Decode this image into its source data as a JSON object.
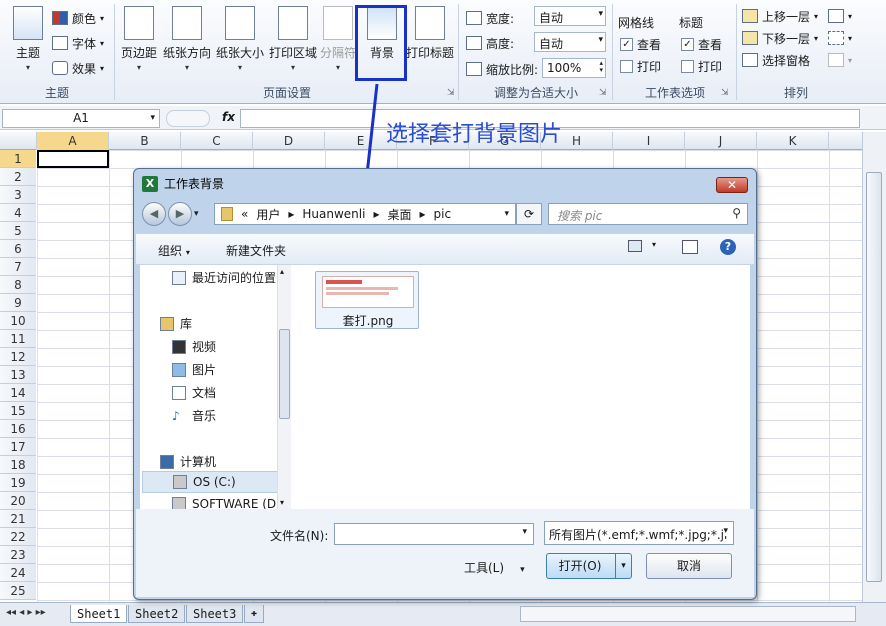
{
  "ribbon": {
    "groups": {
      "theme": "主题",
      "page_setup": "页面设置",
      "scale_to_fit": "调整为合适大小",
      "sheet_options": "工作表选项",
      "arrange": "排列"
    },
    "theme_btn": "主题",
    "colors": "颜色",
    "fonts": "字体",
    "effects": "效果",
    "margins": "页边距",
    "orientation": "纸张方向",
    "size": "纸张大小",
    "print_area": "打印区域",
    "breaks": "分隔符",
    "background": "背景",
    "print_titles": "打印标题",
    "width_label": "宽度:",
    "width_value": "自动",
    "height_label": "高度:",
    "height_value": "自动",
    "scale_label": "缩放比例:",
    "scale_value": "100%",
    "gridlines": "网格线",
    "headings": "标题",
    "view": "查看",
    "print": "打印",
    "bring_forward": "上移一层",
    "send_backward": "下移一层",
    "selection_pane": "选择窗格"
  },
  "formula_bar": {
    "cell_ref": "A1",
    "fx": "fx"
  },
  "columns": [
    "A",
    "B",
    "C",
    "D",
    "E",
    "F",
    "G",
    "H",
    "I",
    "J",
    "K"
  ],
  "rows": [
    "1",
    "2",
    "3",
    "4",
    "5",
    "6",
    "7",
    "8",
    "9",
    "10",
    "11",
    "12",
    "13",
    "14",
    "15",
    "16",
    "17",
    "18",
    "19",
    "20",
    "21",
    "22",
    "23",
    "24",
    "25"
  ],
  "sheets": [
    "Sheet1",
    "Sheet2",
    "Sheet3"
  ],
  "annotation": "选择套打背景图片",
  "dialog": {
    "title": "工作表背景",
    "address": [
      "«",
      "用户",
      "Huanwenli",
      "桌面",
      "pic"
    ],
    "search_placeholder": "搜索 pic",
    "organize": "组织",
    "new_folder": "新建文件夹",
    "nav": {
      "recent": "最近访问的位置",
      "library": "库",
      "videos": "视频",
      "pictures": "图片",
      "documents": "文档",
      "music": "音乐",
      "computer": "计算机",
      "os_c": "OS (C:)",
      "software_d": "SOFTWARE (D:)"
    },
    "file_name": "套打.png",
    "filename_label": "文件名(N):",
    "filter": "所有图片(*.emf;*.wmf;*.jpg;*.jı",
    "tools": "工具(L)",
    "open": "打开(O)",
    "cancel": "取消"
  }
}
